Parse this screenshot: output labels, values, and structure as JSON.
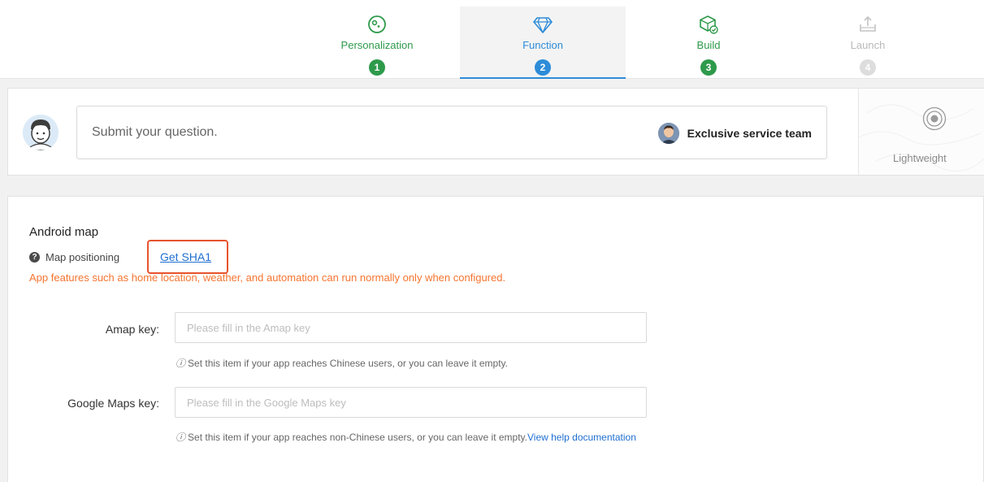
{
  "steps": [
    {
      "label": "Personalization",
      "number": "1",
      "state": "completed",
      "icon": "palette-icon"
    },
    {
      "label": "Function",
      "number": "2",
      "state": "active",
      "icon": "diamond-icon"
    },
    {
      "label": "Build",
      "number": "3",
      "state": "completed",
      "icon": "cube-check-icon"
    },
    {
      "label": "Launch",
      "number": "4",
      "state": "disabled",
      "icon": "upload-tray-icon"
    }
  ],
  "question": {
    "placeholder": "Submit your question.",
    "service_label": "Exclusive service team",
    "lite_label": "Lightweight"
  },
  "section": {
    "title": "Android map",
    "map_positioning_label": "Map positioning",
    "get_sha1_label": "Get SHA1",
    "warning": "App features such as home location, weather, and automation can run normally only when configured."
  },
  "fields": {
    "amap": {
      "label": "Amap key:",
      "placeholder": "Please fill in the Amap key",
      "value": "",
      "hint": "Set this item if your app reaches Chinese users, or you can leave it empty."
    },
    "google": {
      "label": "Google Maps key:",
      "placeholder": "Please fill in the Google Maps key",
      "value": "",
      "hint": "Set this item if your app reaches non-Chinese users, or you can leave it empty.",
      "help_link": "View help documentation"
    }
  },
  "colors": {
    "green": "#2e9a4b",
    "blue": "#2d8cd9",
    "orange_warning": "#f5742f",
    "highlight_red": "#e8532d",
    "link": "#1f6fd1"
  }
}
